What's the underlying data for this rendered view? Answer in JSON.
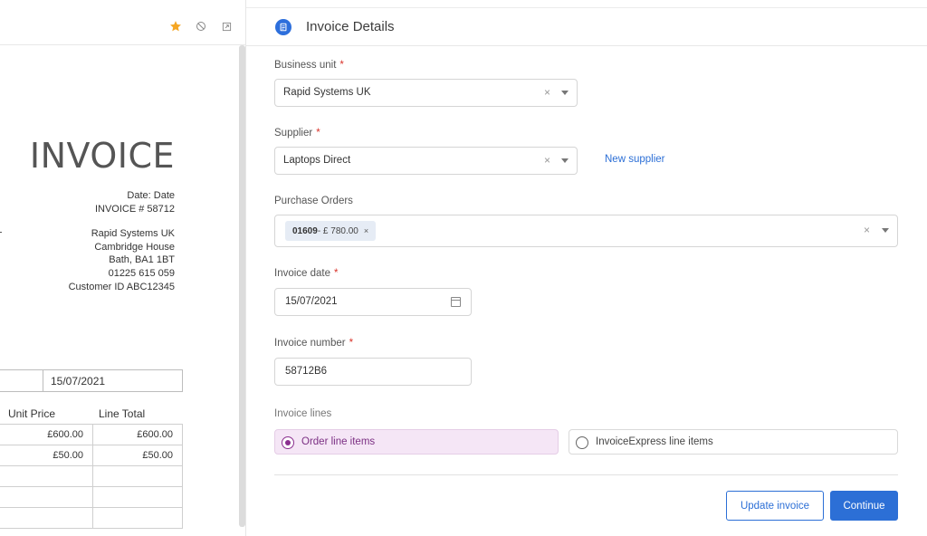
{
  "preview": {
    "toolbar": {
      "star_icon": "star-icon",
      "block_icon": "block-icon",
      "expand_icon": "expand-icon",
      "star_color": "#f5a623"
    },
    "title": "INVOICE",
    "date_line": "Date: Date",
    "invoice_no": "INVOICE # 58712",
    "address": [
      "Rapid Systems UK",
      "Cambridge House",
      "Bath, BA1 1BT",
      "01225 615 059",
      "Customer ID ABC12345"
    ],
    "date_value": "15/07/2021",
    "columns": {
      "unit_price": "Unit Price",
      "line_total": "Line Total"
    },
    "rows": [
      {
        "unit_price": "£600.00",
        "line_total": "£600.00"
      },
      {
        "unit_price": "£50.00",
        "line_total": "£50.00"
      }
    ]
  },
  "header": {
    "title": "Invoice Details",
    "icon": "document-icon",
    "accent": "#2d6fdc"
  },
  "form": {
    "business_unit": {
      "label": "Business unit",
      "required": "*",
      "value": "Rapid Systems UK"
    },
    "supplier": {
      "label": "Supplier",
      "required": "*",
      "value": "Laptops Direct",
      "new_link": "New supplier"
    },
    "purchase_orders": {
      "label": "Purchase Orders",
      "tag_id": "01609",
      "tag_rest": " - £ 780.00",
      "tag_remove": "×"
    },
    "invoice_date": {
      "label": "Invoice date",
      "required": "*",
      "value": "15/07/2021"
    },
    "invoice_number": {
      "label": "Invoice number",
      "required": "*",
      "value": "58712B6"
    },
    "invoice_lines": {
      "label": "Invoice lines",
      "options": [
        {
          "label": "Order line items",
          "selected": true
        },
        {
          "label": "InvoiceExpress line items",
          "selected": false
        }
      ]
    },
    "clear_glyph": "×"
  },
  "actions": {
    "update": "Update invoice",
    "continue": "Continue",
    "primary_color": "#2c6fd6"
  }
}
